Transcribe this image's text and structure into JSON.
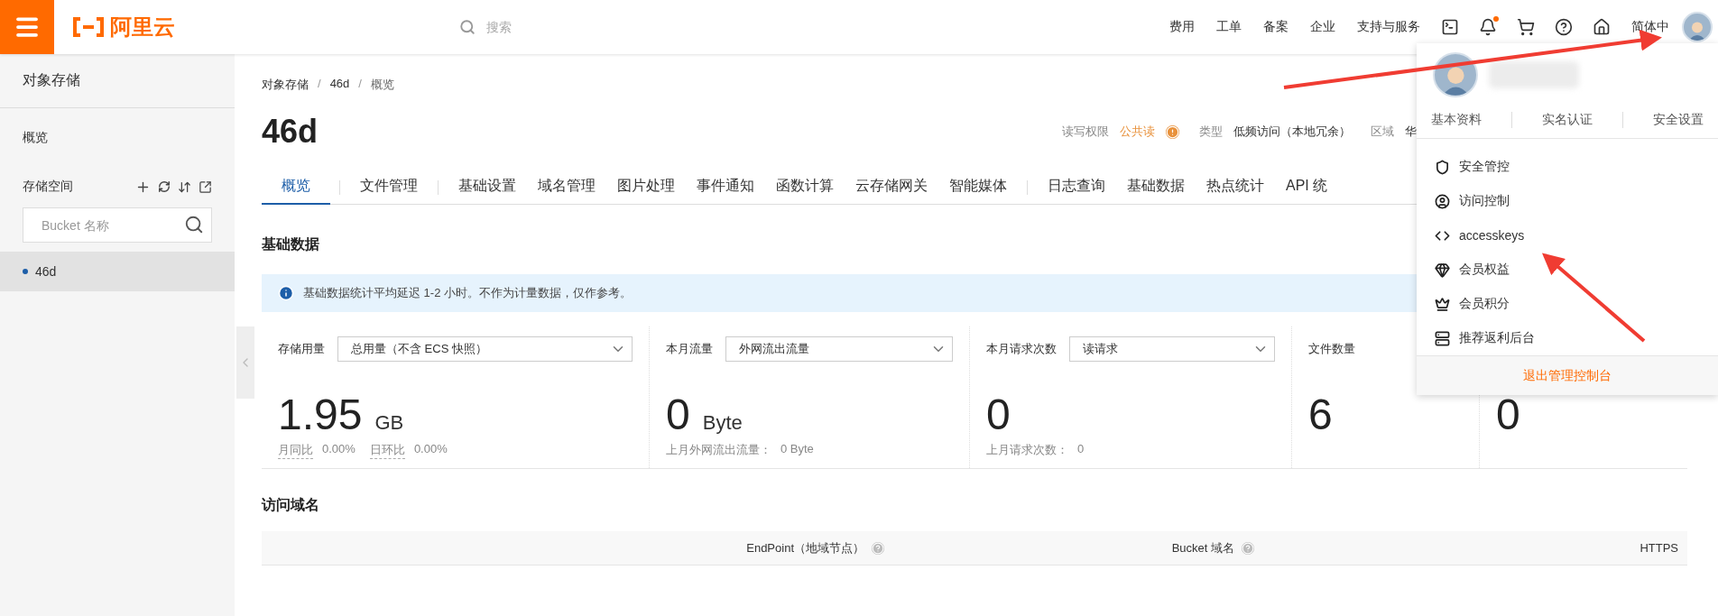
{
  "topbar": {
    "logo": "阿里云",
    "search": {
      "placeholder": "搜索"
    },
    "nav": [
      "费用",
      "工单",
      "备案",
      "企业",
      "支持与服务"
    ],
    "notification_dot": true,
    "language": "简体中"
  },
  "sidebar": {
    "title": "对象存储",
    "overview": "概览",
    "section": "存储空间",
    "search": {
      "placeholder": "Bucket 名称"
    },
    "buckets": [
      {
        "name": "46d",
        "selected": true
      }
    ]
  },
  "breadcrumb": [
    "对象存储",
    "46d",
    "概览"
  ],
  "breadcrumb_separator": "/",
  "title": "46d",
  "meta": [
    {
      "label": "读写权限",
      "value": "公共读",
      "warning": true
    },
    {
      "label": "类型",
      "value": "低频访问（本地冗余）",
      "warning": false
    },
    {
      "label": "区域",
      "value": "华",
      "warning": false
    }
  ],
  "tab_groups": [
    [
      {
        "label": "概览",
        "selected": true
      }
    ],
    [
      {
        "label": "文件管理",
        "selected": false
      }
    ],
    [
      {
        "label": "基础设置",
        "selected": false
      },
      {
        "label": "域名管理",
        "selected": false
      },
      {
        "label": "图片处理",
        "selected": false
      },
      {
        "label": "事件通知",
        "selected": false
      },
      {
        "label": "函数计算",
        "selected": false
      },
      {
        "label": "云存储网关",
        "selected": false
      },
      {
        "label": "智能媒体",
        "selected": false
      }
    ],
    [
      {
        "label": "日志查询",
        "selected": false
      },
      {
        "label": "基础数据",
        "selected": false
      },
      {
        "label": "热点统计",
        "selected": false
      },
      {
        "label": "API 统",
        "selected": false
      }
    ]
  ],
  "section_title": "基础数据",
  "notice": "基础数据统计平均延迟 1-2 小时。不作为计量数据，仅作参考。",
  "stats": [
    {
      "label": "存储用量",
      "select": "总用量（不含 ECS 快照）",
      "value": "1.95",
      "unit": "GB",
      "foot": [
        {
          "label": "月同比",
          "value": "0.00%",
          "dotted": true
        },
        {
          "label": "日环比",
          "value": "0.00%",
          "dotted": true
        }
      ]
    },
    {
      "label": "本月流量",
      "select": "外网流出流量",
      "value": "0",
      "unit": "Byte",
      "foot": [
        {
          "label": "上月外网流出流量：",
          "value": "0 Byte",
          "dotted": false
        }
      ]
    },
    {
      "label": "本月请求次数",
      "select": "读请求",
      "value": "0",
      "foot": [
        {
          "label": "上月请求次数：",
          "value": "0",
          "dotted": false
        }
      ]
    },
    {
      "label": "文件数量",
      "value": "6"
    },
    {
      "value": "0"
    }
  ],
  "domain_section": {
    "title": "访问域名",
    "columns": [
      "EndPoint（地域节点）",
      "Bucket 域名",
      "HTTPS"
    ]
  },
  "user_menu": {
    "links": [
      "基本资料",
      "实名认证",
      "安全设置"
    ],
    "items": [
      "安全管控",
      "访问控制",
      "accesskeys",
      "会员权益",
      "会员积分",
      "推荐返利后台"
    ],
    "logout": "退出管理控制台"
  }
}
